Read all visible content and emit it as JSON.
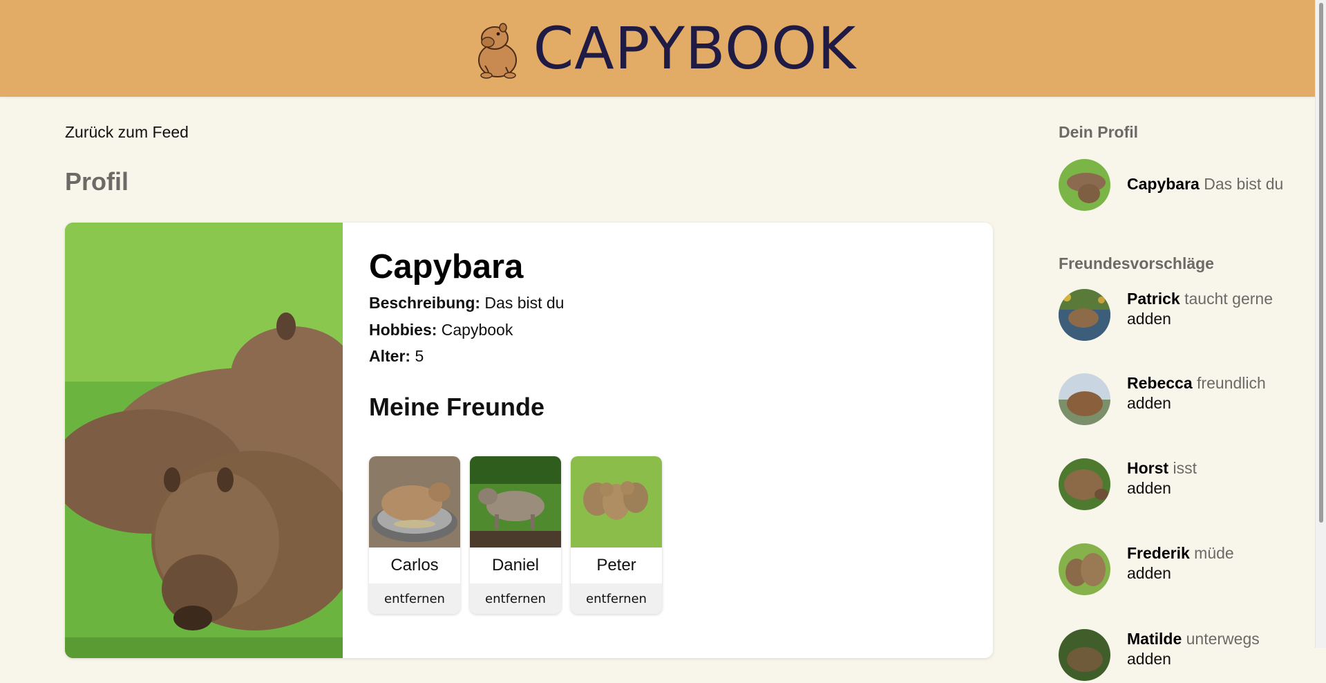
{
  "header": {
    "title": "CAPYBOOK",
    "logo_icon": "capybara-logo-icon"
  },
  "nav": {
    "back_label": "Zurück zum Feed"
  },
  "page": {
    "title": "Profil"
  },
  "profile": {
    "name": "Capybara",
    "description_label": "Beschreibung:",
    "description": "Das bist du",
    "hobbies_label": "Hobbies:",
    "hobbies": "Capybook",
    "age_label": "Alter:",
    "age": "5",
    "friends_heading": "Meine Freunde",
    "friends": [
      {
        "name": "Carlos",
        "action": "entfernen"
      },
      {
        "name": "Daniel",
        "action": "entfernen"
      },
      {
        "name": "Peter",
        "action": "entfernen"
      }
    ]
  },
  "sidebar": {
    "own_title": "Dein Profil",
    "own": {
      "name": "Capybara",
      "desc": "Das bist du"
    },
    "suggestions_title": "Freundesvorschläge",
    "suggestions": [
      {
        "name": "Patrick",
        "desc": "taucht gerne",
        "action": "adden"
      },
      {
        "name": "Rebecca",
        "desc": "freundlich",
        "action": "adden"
      },
      {
        "name": "Horst",
        "desc": "isst",
        "action": "adden"
      },
      {
        "name": "Frederik",
        "desc": "müde",
        "action": "adden"
      },
      {
        "name": "Matilde",
        "desc": "unterwegs",
        "action": "adden"
      }
    ]
  },
  "colors": {
    "header_bg": "#e2ac66",
    "page_bg": "#f8f5ea",
    "title_text": "#1f1b45",
    "muted_text": "#6b6a66"
  }
}
